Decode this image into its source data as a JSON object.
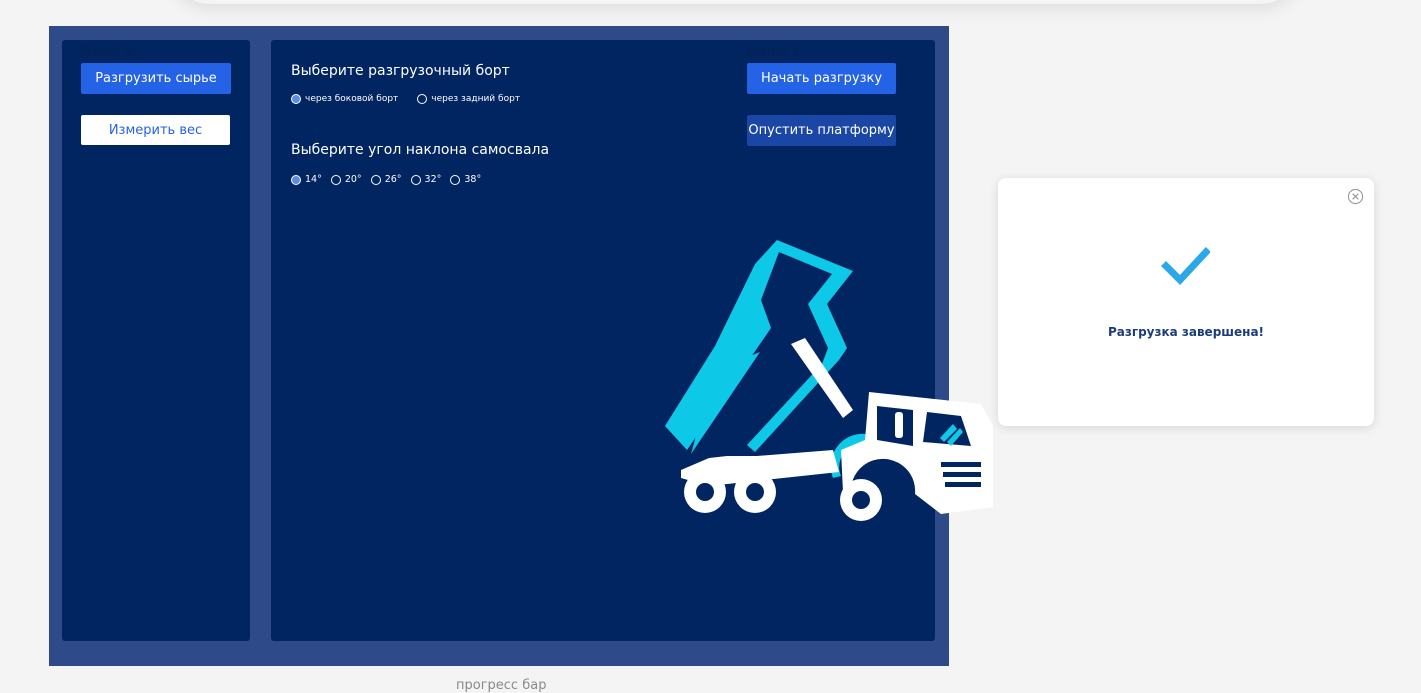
{
  "frames": {
    "left_label": "Frame 5",
    "main_label": "Frame 5"
  },
  "left_panel": {
    "unload_button": "Разгрузить сырье",
    "weigh_button": "Измерить вес"
  },
  "main_panel": {
    "side_heading": "Выберите разгрузочный борт",
    "side_options": [
      {
        "label": "через боковой борт",
        "checked": true
      },
      {
        "label": "через задний борт",
        "checked": false
      }
    ],
    "angle_heading": "Выберите угол наклона самосвала",
    "angle_options": [
      {
        "label": "14°",
        "checked": true
      },
      {
        "label": "20°",
        "checked": false
      },
      {
        "label": "26°",
        "checked": false
      },
      {
        "label": "32°",
        "checked": false
      },
      {
        "label": "38°",
        "checked": false
      }
    ],
    "start_button": "Начать разгрузку",
    "lower_button": "Опустить платформу",
    "illustration_icon": "dump-truck-icon"
  },
  "modal": {
    "message": "Разгрузка завершена!",
    "success_icon": "checkmark-icon",
    "close_icon": "close-circle-icon"
  },
  "progress_label": "прогресс бар",
  "colors": {
    "background": "#f4f4f4",
    "frame": "#2e4a88",
    "panel": "#002561",
    "primary": "#2463e6",
    "accent": "#0ec8e8"
  }
}
